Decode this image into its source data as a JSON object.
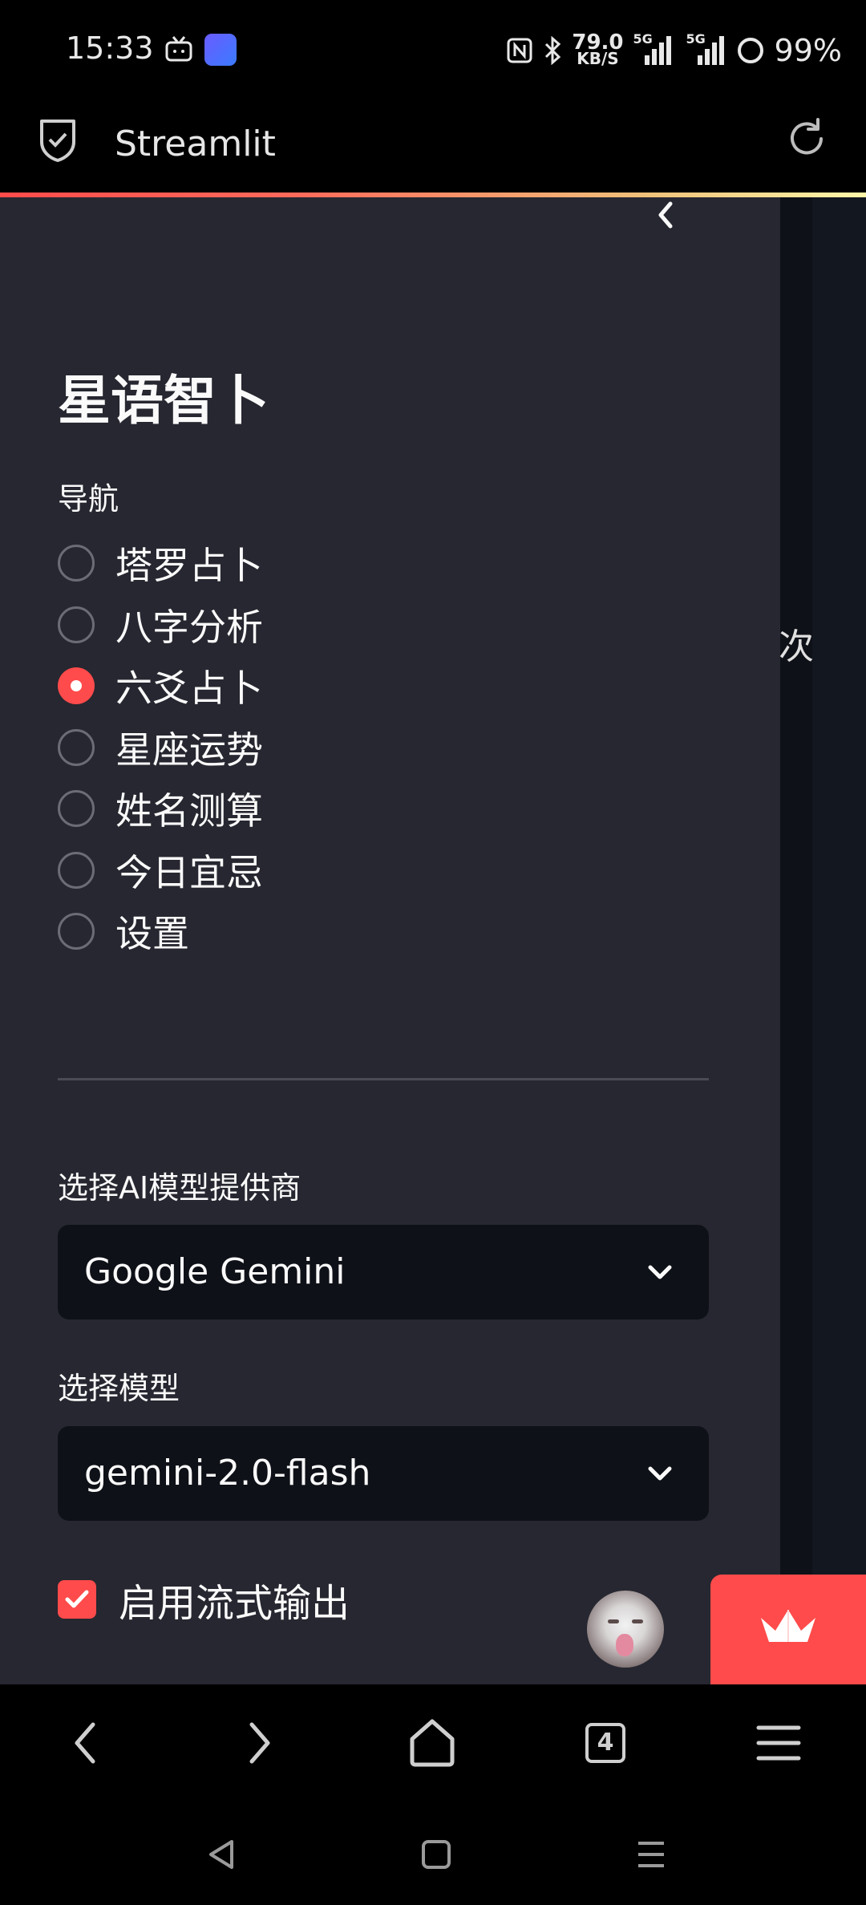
{
  "status_bar": {
    "time": "15:33",
    "speed_value": "79.0",
    "speed_unit": "KB/S",
    "network1": "5G",
    "network2": "5G",
    "battery": "99%"
  },
  "app_bar": {
    "title": "Streamlit"
  },
  "sidebar": {
    "title": "星语智卜",
    "nav_label": "导航",
    "nav_items": [
      {
        "label": "塔罗占卜",
        "selected": false
      },
      {
        "label": "八字分析",
        "selected": false
      },
      {
        "label": "六爻占卜",
        "selected": true
      },
      {
        "label": "星座运势",
        "selected": false
      },
      {
        "label": "姓名测算",
        "selected": false
      },
      {
        "label": "今日宜忌",
        "selected": false
      },
      {
        "label": "设置",
        "selected": false
      }
    ],
    "provider_label": "选择AI模型提供商",
    "provider_value": "Google Gemini",
    "model_label": "选择模型",
    "model_value": "gemini-2.0-flash",
    "streaming_label": "启用流式输出",
    "streaming_checked": true
  },
  "main": {
    "partial_text": "次"
  },
  "browser_bar": {
    "tab_count": "4"
  },
  "colors": {
    "accent": "#ff4b4b",
    "sidebar_bg": "#262730",
    "main_bg": "#0e1117"
  }
}
